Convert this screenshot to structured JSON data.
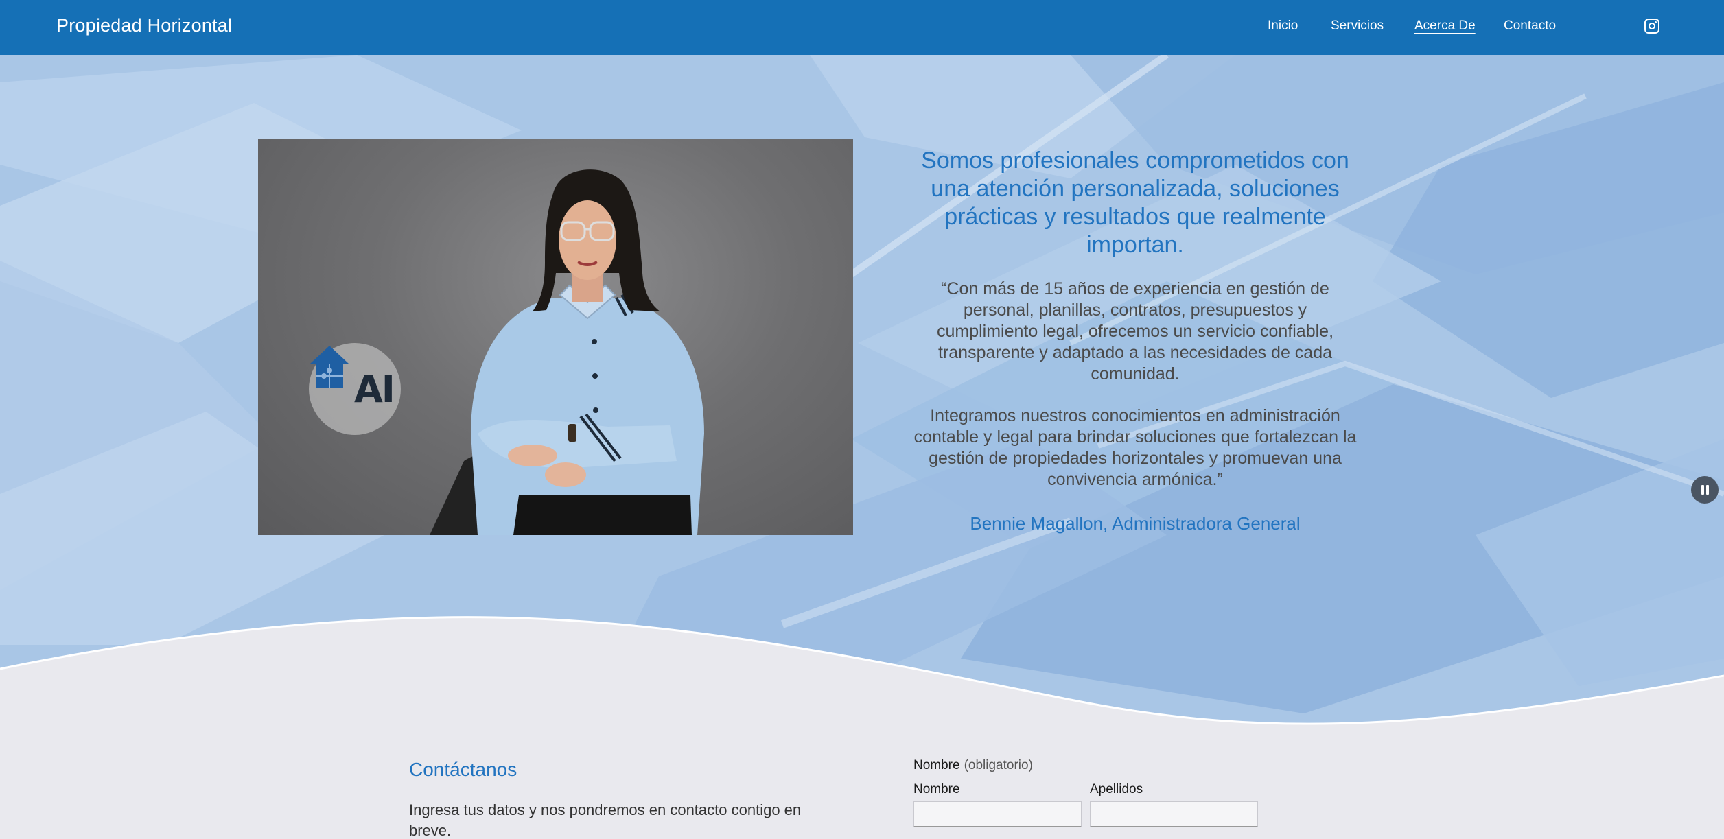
{
  "header": {
    "site_title": "Propiedad Horizontal",
    "nav": [
      {
        "label": "Inicio",
        "active": false
      },
      {
        "label": "Servicios",
        "active": false
      },
      {
        "label": "Acerca De",
        "active": true
      },
      {
        "label": "Contacto",
        "active": false
      }
    ],
    "social_icon": "instagram-icon"
  },
  "hero": {
    "photo_logo_text": "AI",
    "headline": "Somos profesionales comprometidos con una atención personalizada, soluciones prácticas y resultados que realmente importan.",
    "paragraph_1": "“Con más de 15 años de experiencia en gestión de personal, planillas, contratos, presupuestos y cumplimiento legal, ofrecemos un servicio confiable, transparente y adaptado a las necesidades de cada comunidad.",
    "paragraph_2": "Integramos nuestros conocimientos en administración contable y legal para brindar soluciones que fortalezcan la gestión de propiedades horizontales y promuevan una convivencia armónica.”",
    "signature": "Bennie Magallon, Administradora General",
    "pause_icon": "pause-icon"
  },
  "contact": {
    "title": "Contáctanos",
    "description": "Ingresa tus datos y nos pondremos en contacto contigo en breve.",
    "name_label": "Nombre",
    "required_note": "(obligatorio)",
    "first_name_label": "Nombre",
    "last_name_label": "Apellidos",
    "first_name_value": "",
    "last_name_value": ""
  },
  "colors": {
    "header_bg": "#1570b6",
    "accent_text": "#2274c0",
    "hero_bg": "#a9c6e6",
    "section_bg": "#e9e9ee"
  }
}
